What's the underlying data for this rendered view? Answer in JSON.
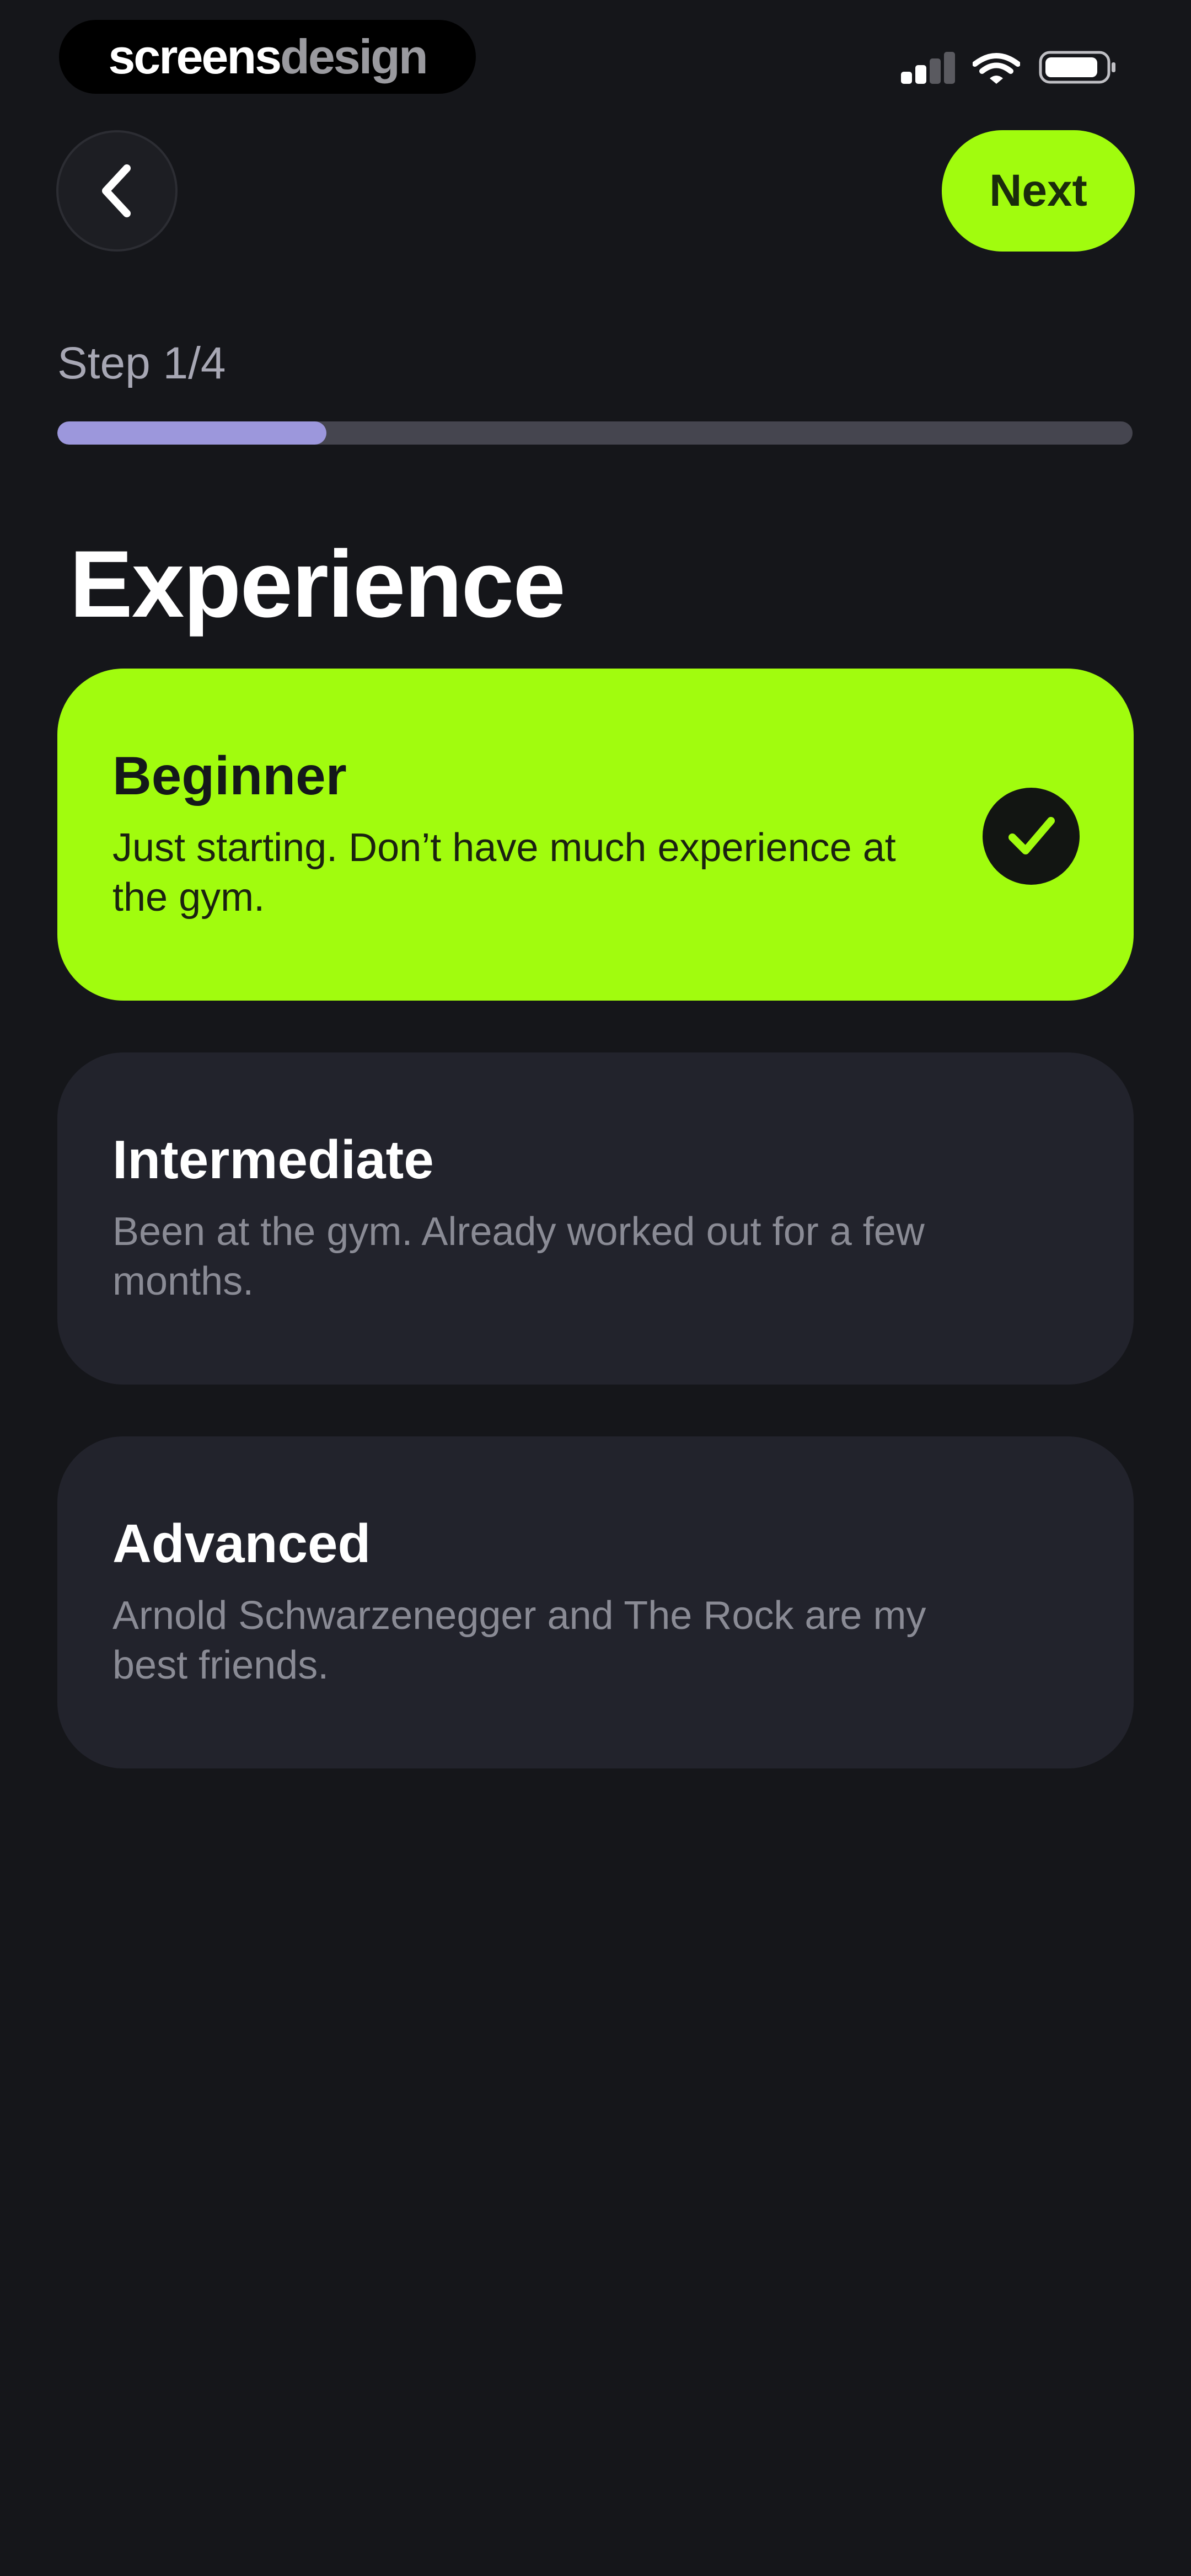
{
  "watermark": {
    "part1": "screens",
    "part2": "design"
  },
  "colors": {
    "background": "#15161a",
    "accent": "#a1fc0e",
    "card": "#22232c",
    "progress_fill": "#9c97dc",
    "progress_track": "#45454f"
  },
  "nav": {
    "back_icon": "chevron-left-icon",
    "next_label": "Next"
  },
  "progress": {
    "label": "Step 1/4",
    "fraction": 0.25
  },
  "page_title": "Experience",
  "options": [
    {
      "name": "Beginner",
      "description": "Just starting. Don’t have much experience at the gym.",
      "selected": true
    },
    {
      "name": "Intermediate",
      "description": "Been at the gym. Already worked out for a few months.",
      "selected": false
    },
    {
      "name": "Advanced",
      "description": "Arnold Schwarzenegger and The Rock are my best friends.",
      "selected": false
    }
  ]
}
